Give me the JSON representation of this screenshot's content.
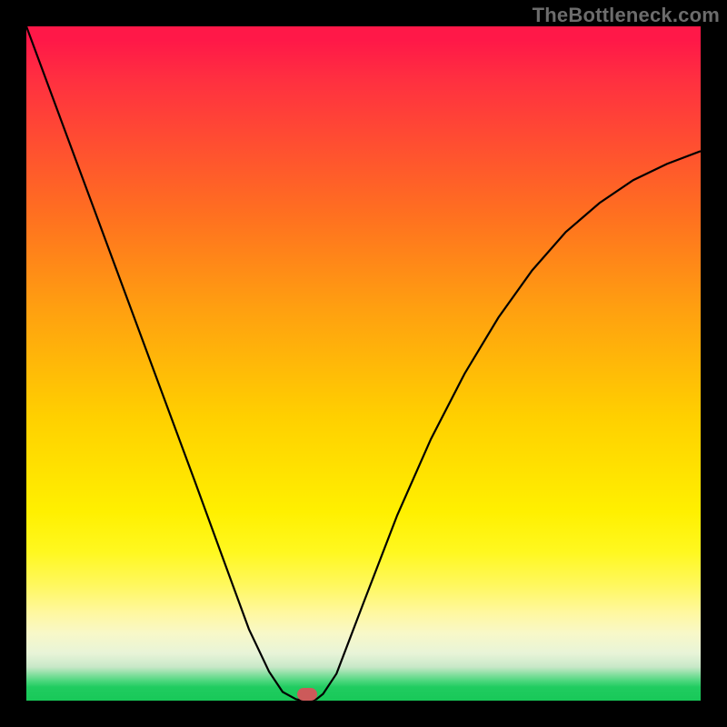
{
  "watermark": "TheBottleneck.com",
  "chart_data": {
    "type": "line",
    "title": "",
    "xlabel": "",
    "ylabel": "",
    "xlim": [
      0,
      100
    ],
    "ylim": [
      0,
      100
    ],
    "series": [
      {
        "name": "bottleneck-curve",
        "x": [
          0,
          5,
          10,
          15,
          20,
          25,
          30,
          33,
          36,
          38,
          40,
          41,
          42,
          43,
          44,
          46,
          50,
          55,
          60,
          65,
          70,
          75,
          80,
          85,
          90,
          95,
          100
        ],
        "y": [
          100,
          86.5,
          73,
          59.5,
          46,
          32.5,
          18.8,
          10.6,
          4.3,
          1.3,
          0.2,
          0,
          0,
          0.2,
          1.0,
          4.0,
          14.5,
          27.5,
          38.8,
          48.5,
          56.8,
          63.8,
          69.5,
          73.8,
          77.2,
          79.6,
          81.5
        ]
      }
    ],
    "marker": {
      "x_pct": 41.6,
      "y_pct": 99.2
    },
    "gradient_stops": [
      {
        "pct": 0,
        "color": "#ff1848"
      },
      {
        "pct": 50,
        "color": "#ffd000"
      },
      {
        "pct": 88,
        "color": "#fff8b0"
      },
      {
        "pct": 100,
        "color": "#18c858"
      }
    ]
  }
}
